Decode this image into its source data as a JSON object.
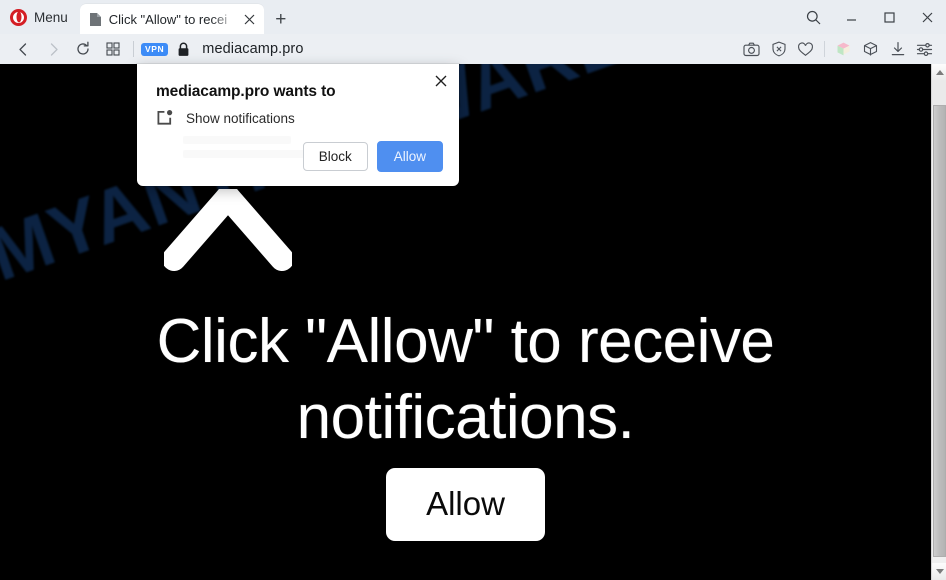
{
  "browser": {
    "name": "Opera",
    "menu_label": "Menu",
    "tab": {
      "title": "Click \"Allow\" to recei",
      "favicon": "document-icon",
      "close": "×"
    },
    "new_tab_label": "+",
    "window_controls": {
      "search": "search-icon",
      "minimize": "_",
      "maximize": "□",
      "close": "×"
    },
    "nav": {
      "back": "back-arrow-icon",
      "forward": "forward-arrow-icon",
      "reload": "reload-icon",
      "tiles": "speed-dial-icon"
    },
    "address_bar": {
      "vpn_badge": "VPN",
      "lock": "padlock-icon",
      "url": "mediacamp.pro"
    },
    "toolbar_right": [
      "snapshot-camera-icon",
      "ad-blocker-shield-icon",
      "heart-icon",
      "cube-color-icon",
      "cube-outline-icon",
      "downloads-icon",
      "easy-setup-sliders-icon"
    ]
  },
  "permission_dialog": {
    "title": "mediacamp.pro wants to",
    "permission": "Show notifications",
    "permission_icon": "notification-badge-icon",
    "block_label": "Block",
    "allow_label": "Allow",
    "close_label": "×",
    "accent_color": "#4f8ff0"
  },
  "page": {
    "background_color": "#000000",
    "watermark": "MYANTISPYWARE.COM",
    "watermark_color": "#0d2546",
    "arrow_icon": "up-arrow-icon",
    "headline": "Click \"Allow\" to receive notifications.",
    "headline_color": "#ffffff",
    "cta_label": "Allow"
  },
  "scrollbar": {
    "up_arrow": "scroll-up-icon",
    "down_arrow": "scroll-down-icon"
  }
}
